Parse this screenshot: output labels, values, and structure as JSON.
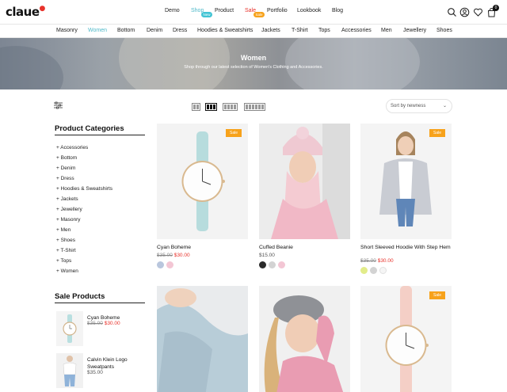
{
  "header": {
    "logo": "claue",
    "nav": [
      "Demo",
      "Shop",
      "Product",
      "Sale",
      "Portfolio",
      "Lookbook",
      "Blog"
    ],
    "badges": {
      "shop": "New",
      "sale": "Sale"
    },
    "cart_count": "0",
    "icons": [
      "search-icon",
      "user-icon",
      "heart-icon",
      "bag-icon"
    ]
  },
  "categories": [
    "Masonry",
    "Women",
    "Bottom",
    "Denim",
    "Dress",
    "Hoodies & Sweatshirts",
    "Jackets",
    "T-Shirt",
    "Tops",
    "Accessories",
    "Men",
    "Jewellery",
    "Shoes"
  ],
  "banner": {
    "title": "Women",
    "subtitle": "Shop through our latest selection of Women's Clothing and Accessories."
  },
  "toolbar": {
    "sort_label": "Sort by newness",
    "active_view": 2
  },
  "sidebar": {
    "categories_heading": "Product Categories",
    "category_items": [
      "Accessories",
      "Bottom",
      "Denim",
      "Dress",
      "Hoodies & Sweatshirts",
      "Jackets",
      "Jewellery",
      "Masonry",
      "Men",
      "Shoes",
      "T-Shirt",
      "Tops",
      "Women"
    ],
    "sale_heading": "Sale Products",
    "sale_products": [
      {
        "name": "Cyan Boheme",
        "old_price": "$35.00",
        "price": "$30.00"
      },
      {
        "name": "Calvin Klein Logo Sweatpants",
        "price": "$35.00"
      }
    ]
  },
  "products": [
    {
      "name": "Cyan Boheme",
      "old_price": "$35.00",
      "price": "$30.00",
      "badge": "Sale",
      "swatches": [
        "#b9c6dd",
        "#f3c6d4"
      ]
    },
    {
      "name": "Cuffed Beanie",
      "price": "$15.00",
      "swatches": [
        "#2b2b2b",
        "#d3d3d3",
        "#f3c6d4"
      ]
    },
    {
      "name": "Short Sleeved Hoodie With Step Hem",
      "old_price": "$35.00",
      "price": "$30.00",
      "badge": "Sale",
      "swatches": [
        "#e2ec8a",
        "#d3d3d3",
        "#f5f5f5"
      ]
    },
    {
      "badge": ""
    },
    {
      "badge": ""
    },
    {
      "badge": "Sale"
    }
  ],
  "colors": {
    "accent": "#4fb9c9",
    "sale": "#e8322b",
    "badge": "#f7a21b"
  }
}
